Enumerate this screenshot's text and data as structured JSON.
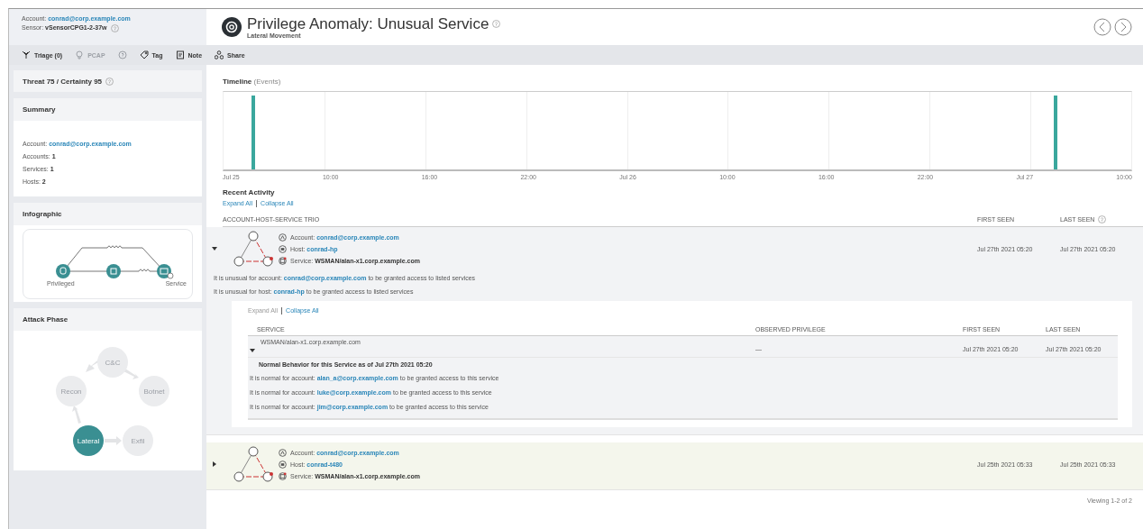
{
  "header": {
    "account_label": "Account:",
    "account": "conrad@corp.example.com",
    "sensor_label": "Sensor:",
    "sensor": "vSensorCPG1-2-37w",
    "title": "Privilege Anomaly: Unusual Service",
    "subtitle": "Lateral Movement"
  },
  "toolbar": [
    {
      "kind": "triage",
      "label": "Triage (0)",
      "disabled": false
    },
    {
      "kind": "pcap",
      "label": "PCAP",
      "disabled": true
    },
    {
      "kind": "help",
      "disabled": true
    },
    {
      "kind": "tag",
      "label": "Tag",
      "disabled": false
    },
    {
      "kind": "note",
      "label": "Note",
      "disabled": false
    },
    {
      "kind": "share",
      "label": "Share",
      "disabled": false
    }
  ],
  "score": "Threat 75 / Certainty 95",
  "summary": {
    "title": "Summary",
    "lines": [
      {
        "label": "Account:",
        "value": "conrad@corp.example.com",
        "link": true
      },
      {
        "label": "Accounts:",
        "value": "1",
        "link": false
      },
      {
        "label": "Services:",
        "value": "1",
        "link": false
      },
      {
        "label": "Hosts:",
        "value": "2",
        "link": false
      }
    ]
  },
  "infographic": {
    "title": "Infographic",
    "labels": [
      "Privileged",
      "Service"
    ]
  },
  "attack_phase": {
    "title": "Attack Phase",
    "phases": [
      {
        "label": "C&C",
        "selected": false
      },
      {
        "label": "Botnet",
        "selected": false
      },
      {
        "label": "Exfil",
        "selected": false
      },
      {
        "label": "Lateral",
        "selected": true
      },
      {
        "label": "Recon",
        "selected": false
      }
    ]
  },
  "timeline": {
    "title": "Timeline",
    "unit": "(Events)",
    "ticks": [
      "Jul 25",
      "10:00",
      "16:00",
      "22:00",
      "Jul 26",
      "10:00",
      "16:00",
      "22:00",
      "Jul 27",
      "10:00"
    ]
  },
  "recent": {
    "title": "Recent Activity",
    "expand": "Expand All",
    "collapse": "Collapse All",
    "columns": [
      "ACCOUNT-HOST-SERVICE TRIO",
      "FIRST SEEN",
      "LAST SEEN"
    ],
    "rows": [
      {
        "expanded": true,
        "highlighted": false,
        "account_label": "Account:",
        "account": "conrad@corp.example.com",
        "host_label": "Host:",
        "host": "conrad-hp",
        "service_label": "Service:",
        "service": "WSMAN/alan-x1.corp.example.com",
        "first_seen": "Jul 27th 2021 05:20",
        "last_seen": "Jul 27th 2021 05:20",
        "notes": [
          {
            "before": "It is unusual for account:",
            "link": "conrad@corp.example.com",
            "after": "to be granted access to listed services"
          },
          {
            "before": "It is unusual for host:",
            "link": "conrad-hp",
            "after": "to be granted access to listed services"
          }
        ],
        "details": {
          "expand": "Expand All",
          "expand_disabled": true,
          "collapse": "Collapse All",
          "columns": [
            "SERVICE",
            "OBSERVED PRIVILEGE",
            "FIRST SEEN",
            "LAST SEEN"
          ],
          "rows": [
            {
              "expanded": true,
              "service": "WSMAN/alan-x1.corp.example.com",
              "privilege": "—",
              "first_seen": "Jul 27th 2021 05:20",
              "last_seen": "Jul 27th 2021 05:20",
              "normal_title": "Normal Behavior for this Service as of Jul 27th 2021 05:20",
              "normal": [
                {
                  "before": "It is normal for account:",
                  "link": "alan_a@corp.example.com",
                  "after": "to be granted access to this service"
                },
                {
                  "before": "It is normal for account:",
                  "link": "luke@corp.example.com",
                  "after": "to be granted access to this service"
                },
                {
                  "before": "It is normal for account:",
                  "link": "jim@corp.example.com",
                  "after": "to be granted access to this service"
                }
              ]
            }
          ]
        }
      },
      {
        "expanded": false,
        "highlighted": true,
        "account_label": "Account:",
        "account": "conrad@corp.example.com",
        "host_label": "Host:",
        "host": "conrad-t480",
        "service_label": "Service:",
        "service": "WSMAN/alan-x1.corp.example.com",
        "first_seen": "Jul 25th 2021 05:33",
        "last_seen": "Jul 25th 2021 05:33"
      }
    ]
  },
  "footer": "Viewing 1-2 of 2"
}
